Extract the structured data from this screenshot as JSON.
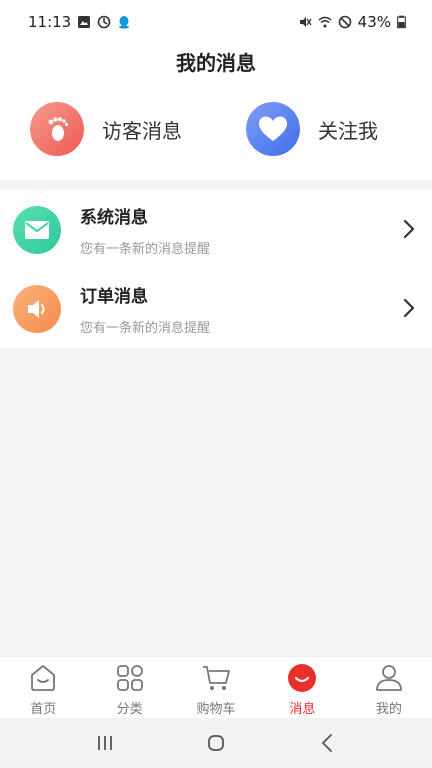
{
  "status_bar": {
    "time": "11:13",
    "battery": "43%"
  },
  "header": {
    "title": "我的消息"
  },
  "top_cards": [
    {
      "label": "访客消息",
      "icon": "footprint-icon",
      "color_from": "#f69a8e",
      "color_to": "#ee5a52"
    },
    {
      "label": "关注我",
      "icon": "heart-icon",
      "color_from": "#7fa0f8",
      "color_to": "#3f6de8"
    }
  ],
  "list": [
    {
      "title": "系统消息",
      "subtitle": "您有一条新的消息提醒",
      "icon": "mail-icon",
      "color_from": "#59e0b4",
      "color_to": "#2fc89a"
    },
    {
      "title": "订单消息",
      "subtitle": "您有一条新的消息提醒",
      "icon": "speaker-icon",
      "color_from": "#fbb27c",
      "color_to": "#f58a4c"
    }
  ],
  "tabbar": [
    {
      "label": "首页",
      "icon": "home-icon",
      "active": false
    },
    {
      "label": "分类",
      "icon": "category-icon",
      "active": false
    },
    {
      "label": "购物车",
      "icon": "cart-icon",
      "active": false
    },
    {
      "label": "消息",
      "icon": "message-icon",
      "active": true
    },
    {
      "label": "我的",
      "icon": "user-icon",
      "active": false
    }
  ],
  "colors": {
    "accent": "#e8302a",
    "background": "#f5f5f5"
  }
}
